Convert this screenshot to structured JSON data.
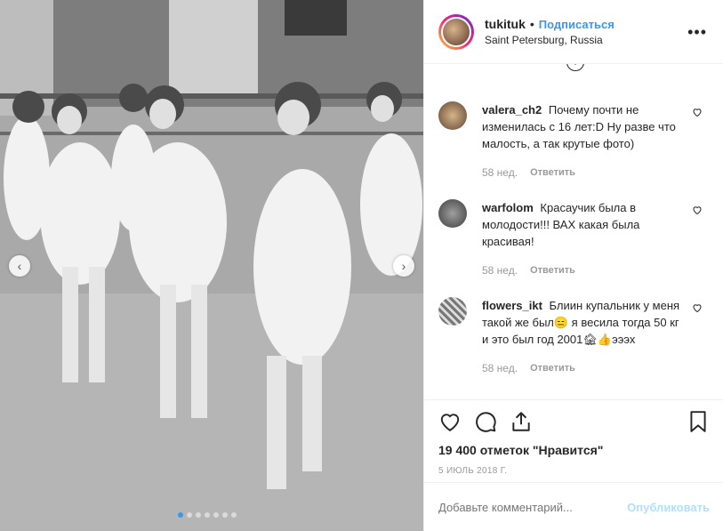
{
  "post": {
    "username": "tukituk",
    "separator": "•",
    "follow_label": "Подписаться",
    "location": "Saint Petersburg, Russia",
    "more_icon": "more-icon"
  },
  "carousel": {
    "slide_count": 7,
    "active_index": 0,
    "prev_icon": "chevron-left-icon",
    "next_icon": "chevron-right-icon"
  },
  "comments": [
    {
      "username": "valera_ch2",
      "text": "Почему почти не изменилась с 16 лет:D Ну разве что малость, а так крутые фото)",
      "time": "58 нед.",
      "reply_label": "Ответить"
    },
    {
      "username": "warfolom",
      "text": "Красаучик была в молодости!!! ВАХ какая была красивая!",
      "time": "58 нед.",
      "reply_label": "Ответить"
    },
    {
      "username": "flowers_ikt",
      "text": "Блиин купальник у меня такой же был😑 я весила тогда 50 кг и это был год 2001🏚👍эээх",
      "time": "58 нед.",
      "reply_label": "Ответить"
    }
  ],
  "actions": {
    "likes_text": "19 400 отметок \"Нравится\"",
    "date": "5 июль 2018 г."
  },
  "add_comment": {
    "placeholder": "Добавьте комментарий...",
    "publish_label": "Опубликовать"
  },
  "colors": {
    "accent": "#3897f0",
    "publish_disabled": "#b2dffc",
    "meta_gray": "#999999"
  }
}
